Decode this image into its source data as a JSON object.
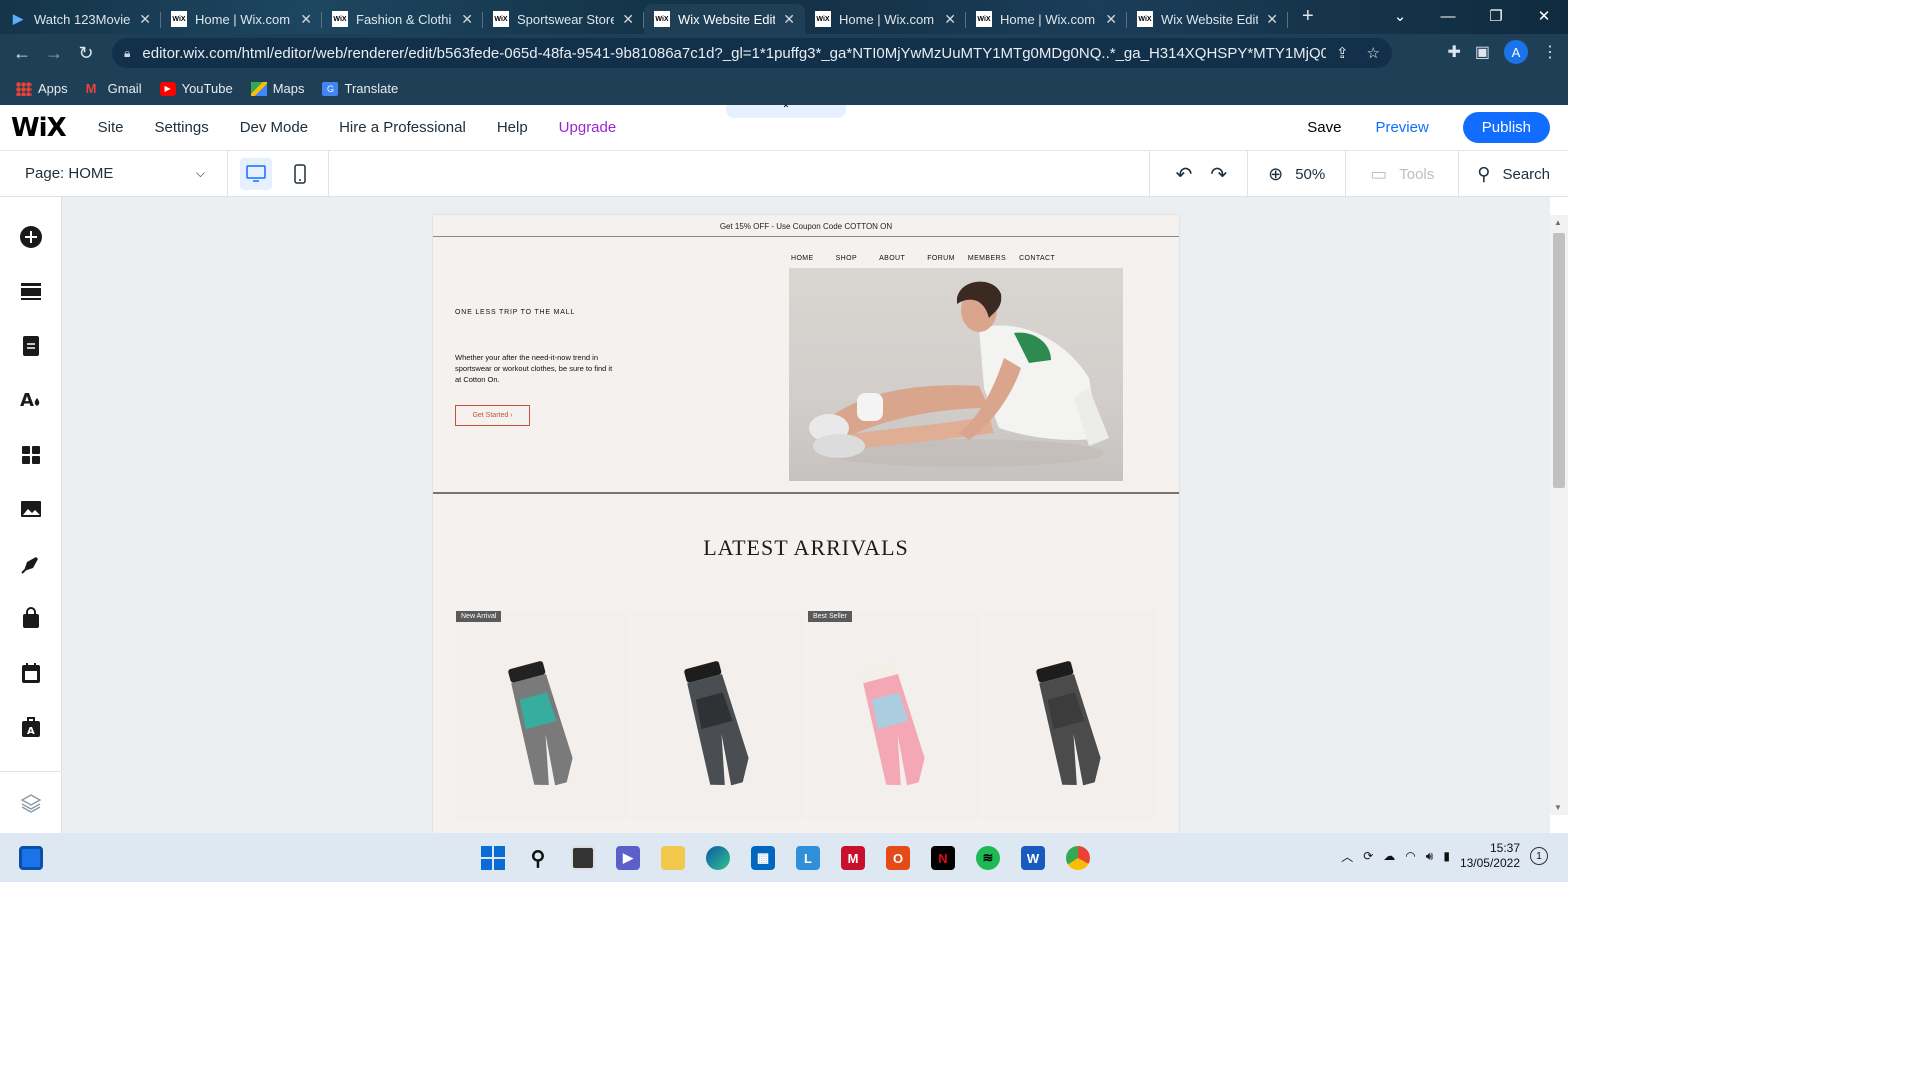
{
  "browser": {
    "tabs": [
      {
        "title": "Watch 123Movies",
        "fav": "▶",
        "active": false
      },
      {
        "title": "Home | Wix.com",
        "fav": "WiX",
        "active": false
      },
      {
        "title": "Fashion & Clothi",
        "fav": "WiX",
        "active": false
      },
      {
        "title": "Sportswear Store",
        "fav": "WiX",
        "active": false
      },
      {
        "title": "Wix Website Edit",
        "fav": "WiX",
        "active": true
      },
      {
        "title": "Home | Wix.com",
        "fav": "WiX",
        "active": false
      },
      {
        "title": "Home | Wix.com",
        "fav": "WiX",
        "active": false
      },
      {
        "title": "Wix Website Edit",
        "fav": "WiX",
        "active": false
      }
    ],
    "url": "editor.wix.com/html/editor/web/renderer/edit/b563fede-065d-48fa-9541-9b81086a7c1d?_gl=1*1puffg3*_ga*NTI0MjYwMzUuMTY1MTg0MDg0NQ..*_ga_H314XQHSPY*MTY1MjQ0MTI4NC4x...",
    "profile_initial": "A",
    "bookmarks": [
      {
        "label": "Apps",
        "icon": "apps-grid-icon"
      },
      {
        "label": "Gmail",
        "icon": "gmail-icon"
      },
      {
        "label": "YouTube",
        "icon": "youtube-icon"
      },
      {
        "label": "Maps",
        "icon": "maps-icon"
      },
      {
        "label": "Translate",
        "icon": "translate-icon"
      }
    ]
  },
  "wix": {
    "logo": "WiX",
    "menu": [
      "Site",
      "Settings",
      "Dev Mode",
      "Hire a Professional",
      "Help",
      "Upgrade"
    ],
    "save": "Save",
    "preview": "Preview",
    "publish": "Publish",
    "page_selector": "Page: HOME",
    "zoom": "50%",
    "tools": "Tools",
    "search": "Search"
  },
  "site": {
    "promo": "Get 15% OFF - Use Coupon Code COTTON ON",
    "nav": [
      "HOME",
      "SHOP",
      "ABOUT",
      "FORUM",
      "MEMBERS",
      "CONTACT"
    ],
    "hero_heading": "ONE LESS TRIP TO THE MALL",
    "hero_text": "Whether your after the need-it-now trend in sportswear or workout clothes, be sure to find it at Cotton On.",
    "hero_button": "Get Started ›",
    "section_title": "LATEST ARRIVALS",
    "products": [
      {
        "badge": "New Arrival",
        "colors": [
          "#7a7a7a",
          "#2ab6a6",
          "#222"
        ]
      },
      {
        "badge": "",
        "colors": [
          "#4a4d52",
          "#2b2d30",
          "#1d1d1d"
        ]
      },
      {
        "badge": "Best Seller",
        "colors": [
          "#f4a7b4",
          "#9fd2e8",
          "#f2efe9"
        ]
      },
      {
        "badge": "",
        "colors": [
          "#4b4b4b",
          "#3a3a3a",
          "#1d1d1d"
        ]
      }
    ]
  },
  "taskbar": {
    "time": "15:37",
    "date": "13/05/2022",
    "notifications": "1"
  }
}
